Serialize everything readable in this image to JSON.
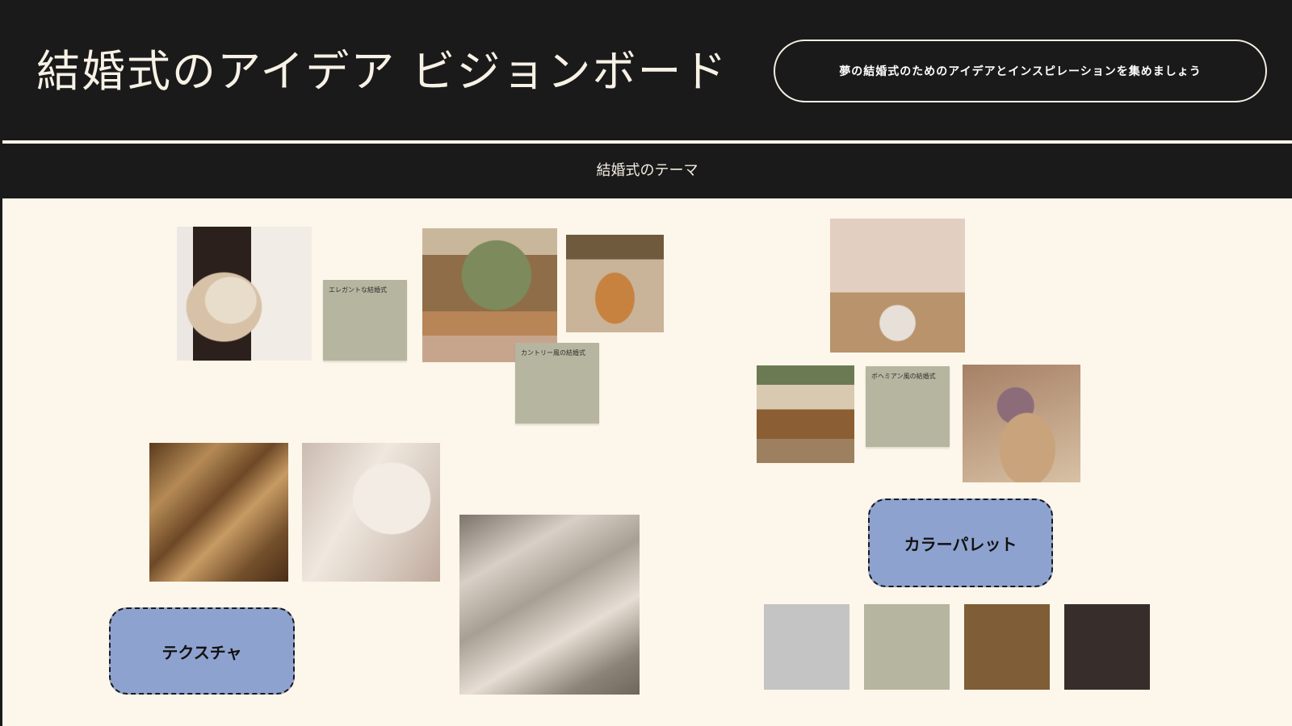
{
  "header": {
    "title": "結婚式のアイデア ビジョンボード",
    "tagline": "夢の結婚式のためのアイデアとインスピレーションを集めましょう"
  },
  "theme": {
    "title": "結婚式のテーマ",
    "captions": {
      "elegant": "エレガントな結婚式",
      "country": "カントリー風の結婚式",
      "boho": "ボヘミアン風の結婚式"
    }
  },
  "buttons": {
    "palette": "カラーパレット",
    "texture": "テクスチャ"
  },
  "palette": {
    "colors": [
      "#c4c4c4",
      "#b6b59f",
      "#7e5d37",
      "#372e2b"
    ]
  }
}
